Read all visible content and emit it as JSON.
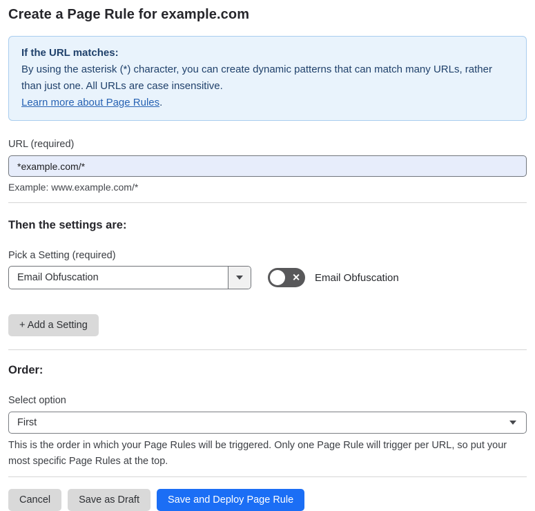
{
  "page": {
    "title": "Create a Page Rule for example.com"
  },
  "info_box": {
    "heading": "If the URL matches:",
    "body": "By using the asterisk (*) character, you can create dynamic patterns that can match many URLs, rather than just one. All URLs are case insensitive.",
    "link_label": "Learn more about Page Rules",
    "link_suffix": "."
  },
  "url_field": {
    "label": "URL (required)",
    "value": "*example.com/*",
    "example": "Example: www.example.com/*"
  },
  "settings_section": {
    "heading": "Then the settings are:",
    "pick_label": "Pick a Setting (required)",
    "selected_setting": "Email Obfuscation",
    "toggle_state": "off",
    "toggle_label": "Email Obfuscation",
    "add_button_label": "+ Add a Setting"
  },
  "order_section": {
    "heading": "Order:",
    "select_label": "Select option",
    "selected_option": "First",
    "help_text": "This is the order in which your Page Rules will be triggered. Only one Page Rule will trigger per URL, so put your most specific Page Rules at the top."
  },
  "footer": {
    "cancel_label": "Cancel",
    "save_draft_label": "Save as Draft",
    "save_deploy_label": "Save and Deploy Page Rule"
  },
  "colors": {
    "info_box_bg": "#e9f3fc",
    "info_box_border": "#a9cdee",
    "info_text": "#20416b",
    "link_blue": "#2762b3",
    "input_bg": "#e7edfb",
    "primary_button_blue": "#1b6ef5",
    "gray_button": "#d9d9d9",
    "toggle_off_bg": "#58585a"
  }
}
